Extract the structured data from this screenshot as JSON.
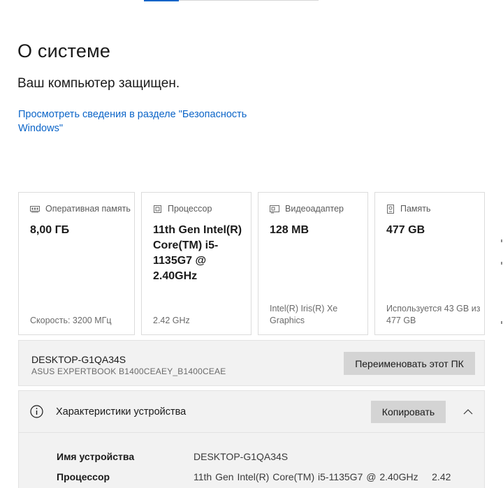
{
  "page_title": "О системе",
  "protection_status": "Ваш компьютер защищен.",
  "security_link": "Просмотреть сведения в разделе \"Безопасность Windows\"",
  "cards": [
    {
      "icon": "memory-icon",
      "label": "Оперативная память",
      "value": "8,00 ГБ",
      "footer": "Скорость: 3200 МГц"
    },
    {
      "icon": "processor-icon",
      "label": "Процессор",
      "value": "11th Gen Intel(R) Core(TM) i5-1135G7 @ 2.40GHz",
      "footer": "2.42 GHz"
    },
    {
      "icon": "video-adapter-icon",
      "label": "Видеоадаптер",
      "value": "128 MB",
      "footer": "Intel(R) Iris(R) Xe Graphics"
    },
    {
      "icon": "storage-icon",
      "label": "Память",
      "value": "477 GB",
      "footer": "Используется 43 GB из 477 GB"
    }
  ],
  "device": {
    "name": "DESKTOP-G1QA34S",
    "model": "ASUS EXPERTBOOK B1400CEAEY_B1400CEAE",
    "rename_label": "Переименовать этот ПК"
  },
  "specs": {
    "title": "Характеристики устройства",
    "copy_label": "Копировать",
    "rows": [
      {
        "label": "Имя устройства",
        "value": "DESKTOP-G1QA34S"
      },
      {
        "label": "Процессор",
        "value": "11th Gen Intel(R) Core(TM) i5-1135G7 @ 2.40GHz    2.42"
      }
    ]
  },
  "colors": {
    "accent": "#0a64c8",
    "panel_background": "#f2f2f2",
    "button_background": "#d4d4d4"
  }
}
